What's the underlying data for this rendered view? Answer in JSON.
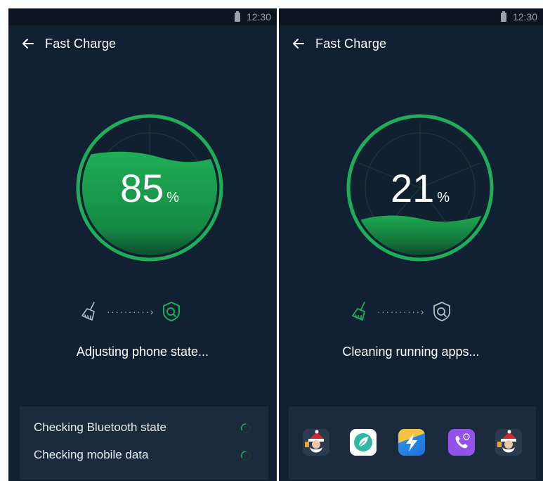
{
  "colors": {
    "screen_bg": "#112033",
    "accent": "#1fae55",
    "card_bg": "#1b2a3c",
    "muted": "#9aa3ad"
  },
  "left_screen": {
    "status_bar": {
      "time": "12:30",
      "battery_icon": "battery-icon"
    },
    "header": {
      "back_icon": "arrow-left-icon",
      "title": "Fast Charge"
    },
    "gauge": {
      "value": "85",
      "unit": "%",
      "fill_fraction": 0.85
    },
    "steps": {
      "from_icon": "broom-icon",
      "dots": "··········›",
      "to_icon": "shield-search-icon",
      "active": "shield-search-icon"
    },
    "status_text": "Adjusting phone state...",
    "checks": [
      {
        "label": "Checking Bluetooth state",
        "status_icon": "loading-spinner-icon"
      },
      {
        "label": "Checking mobile data",
        "status_icon": "loading-spinner-icon"
      }
    ]
  },
  "right_screen": {
    "status_bar": {
      "time": "12:30",
      "battery_icon": "battery-icon"
    },
    "header": {
      "back_icon": "arrow-left-icon",
      "title": "Fast Charge"
    },
    "gauge": {
      "value": "21",
      "unit": "%",
      "fill_fraction": 0.21
    },
    "steps": {
      "from_icon": "broom-icon",
      "dots": "··········›",
      "to_icon": "shield-search-icon",
      "active": "broom-icon"
    },
    "status_text": "Cleaning running apps...",
    "apps": [
      {
        "icon": "santa-game-app-icon"
      },
      {
        "icon": "leaf-cleaner-app-icon"
      },
      {
        "icon": "lightning-app-icon"
      },
      {
        "icon": "phone-call-app-icon"
      },
      {
        "icon": "santa-game-app-icon"
      }
    ]
  }
}
